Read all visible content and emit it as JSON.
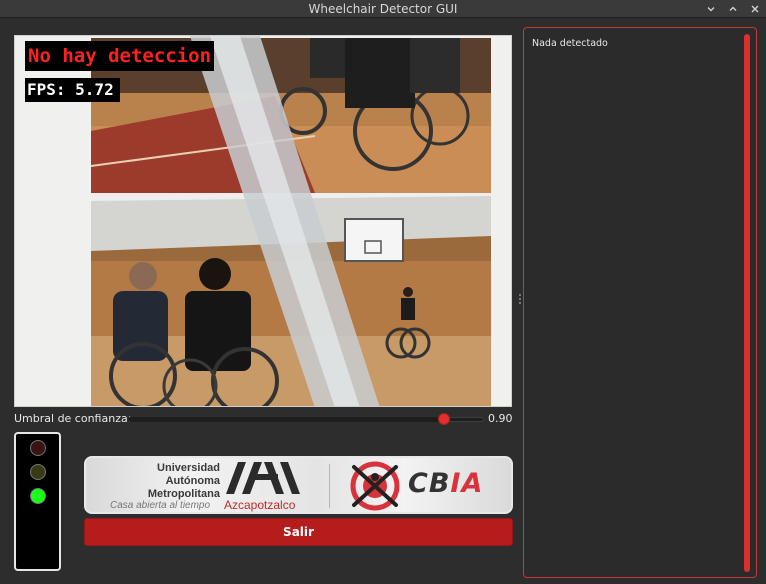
{
  "window": {
    "title": "Wheelchair Detector GUI",
    "controls": {
      "minimize": "⌄",
      "maximize": "⌃",
      "close": "✕"
    }
  },
  "video": {
    "detection_text": "No hay deteccion",
    "fps_text": "FPS: 5.72"
  },
  "confidence": {
    "label": "Umbral de confianza:",
    "value_text": "0.90",
    "value": 0.9
  },
  "traffic_light": {
    "active": "green",
    "colors": {
      "red_off": "#3a1414",
      "yellow_off": "#3a3a14",
      "green_on": "#1aff1a"
    }
  },
  "logos": {
    "uam_name": [
      "Universidad",
      "Autónoma",
      "Metropolitana"
    ],
    "uam_tagline": "Casa abierta al tiempo",
    "uam_unit": "Azcapotzalco",
    "cbia_cb": "CB",
    "cbia_ia": "IA"
  },
  "buttons": {
    "exit_label": "Salir"
  },
  "results_panel": {
    "status_text": "Nada detectado"
  },
  "colors": {
    "accent_red": "#b51d1d",
    "panel_border": "#c23a3a"
  }
}
